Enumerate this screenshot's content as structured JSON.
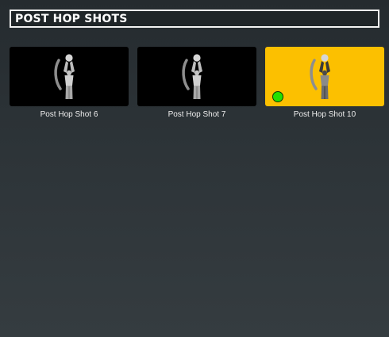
{
  "header": {
    "title": "POST HOP SHOTS"
  },
  "cards": [
    {
      "label": "Post Hop Shot 6",
      "icon": "player-shooting-icon",
      "selected": false
    },
    {
      "label": "Post Hop Shot 7",
      "icon": "player-shooting-icon",
      "selected": false
    },
    {
      "label": "Post Hop Shot 10",
      "icon": "player-shooting-icon",
      "selected": true,
      "status": "equipped"
    }
  ],
  "colors": {
    "selected_card": "#fcc000",
    "card_background": "#000000",
    "status_indicator": "#22e000",
    "header_border": "#f2f2f2"
  }
}
